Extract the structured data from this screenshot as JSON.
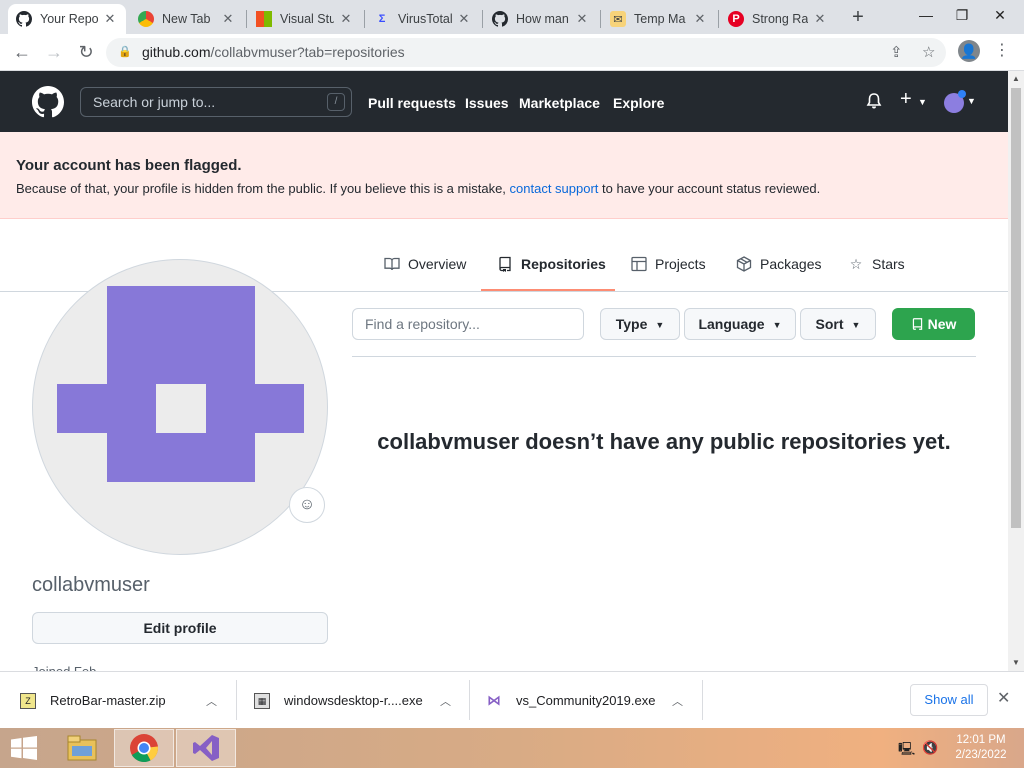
{
  "browser": {
    "tabs": [
      {
        "label": "Your Repo",
        "icon": "github-icon",
        "active": true
      },
      {
        "label": "New Tab",
        "icon": "chrome-icon",
        "active": false
      },
      {
        "label": "Visual Stu",
        "icon": "microsoft-icon",
        "active": false
      },
      {
        "label": "VirusTotal",
        "icon": "virustotal-icon",
        "active": false
      },
      {
        "label": "How man",
        "icon": "github-icon",
        "active": false
      },
      {
        "label": "Temp Ma",
        "icon": "temp-mail-icon",
        "active": false
      },
      {
        "label": "Strong Ra",
        "icon": "pinterest-icon",
        "active": false
      }
    ],
    "new_tab": "+",
    "minimize": "—",
    "restore": "❐",
    "close": "✕",
    "url_host": "github.com",
    "url_path": "/collabvmuser?tab=repositories"
  },
  "github": {
    "search_placeholder": "Search or jump to...",
    "search_key": "/",
    "nav": [
      "Pull requests",
      "Issues",
      "Marketplace",
      "Explore"
    ],
    "plus": "+"
  },
  "flag": {
    "title": "Your account has been flagged.",
    "text_before": "Because of that, your profile is hidden from the public. If you believe this is a mistake, ",
    "link": "contact support",
    "text_after": " to have your account status reviewed."
  },
  "profile_nav": {
    "items": [
      "Overview",
      "Repositories",
      "Projects",
      "Packages",
      "Stars"
    ],
    "selected": "Repositories"
  },
  "profile": {
    "username": "collabvmuser",
    "edit_button": "Edit profile",
    "joined_partial": "Joined Feb"
  },
  "repos": {
    "find_placeholder": "Find a repository...",
    "type_label": "Type",
    "language_label": "Language",
    "sort_label": "Sort",
    "new_label": "New",
    "empty_message": "collabvmuser doesn’t have any public repositories yet."
  },
  "downloads": {
    "items": [
      "RetroBar-master.zip",
      "windowsdesktop-r....exe",
      "vs_Community2019.exe"
    ],
    "show_all": "Show all"
  },
  "taskbar": {
    "time": "12:01 PM",
    "date": "2/23/2022"
  },
  "colors": {
    "github_header": "#24292f",
    "flag_bg": "#ffebe9",
    "new_button": "#2da44e",
    "avatar_identicon": "#8778d8",
    "tab_underline": "#fd8c73",
    "link": "#0969da"
  }
}
